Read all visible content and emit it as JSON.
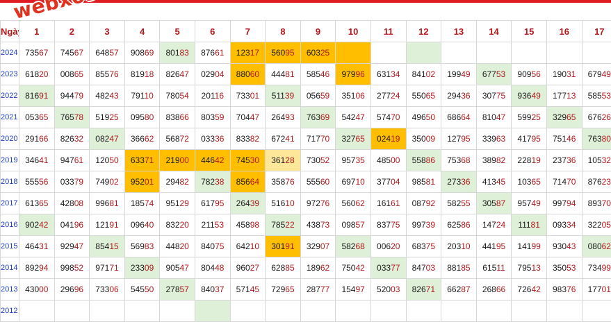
{
  "watermark": "webxoso.net",
  "header": {
    "first_col": "Ngày",
    "days": [
      "1",
      "2",
      "3",
      "4",
      "5",
      "6",
      "7",
      "8",
      "9",
      "10",
      "11",
      "12",
      "13",
      "14",
      "15",
      "16",
      "17"
    ]
  },
  "rows": [
    {
      "year": "2024",
      "cells": [
        {
          "v": "73567",
          "s": "e"
        },
        {
          "v": "74567",
          "s": "e"
        },
        {
          "v": "64857",
          "s": "e"
        },
        {
          "v": "90869",
          "s": "e"
        },
        {
          "v": "80183",
          "s": "g"
        },
        {
          "v": "87661",
          "s": "e"
        },
        {
          "v": "12317",
          "s": "o"
        },
        {
          "v": "56095",
          "s": "o"
        },
        {
          "v": "60325",
          "s": "o"
        },
        {
          "v": "",
          "s": "o"
        },
        {
          "v": "",
          "s": "e"
        },
        {
          "v": "",
          "s": "g"
        },
        {
          "v": "",
          "s": "e"
        },
        {
          "v": "",
          "s": "e"
        },
        {
          "v": "",
          "s": "e"
        },
        {
          "v": "",
          "s": "e"
        },
        {
          "v": "",
          "s": "e"
        }
      ]
    },
    {
      "year": "2023",
      "cells": [
        {
          "v": "61820",
          "s": "e"
        },
        {
          "v": "00865",
          "s": "e"
        },
        {
          "v": "85576",
          "s": "e"
        },
        {
          "v": "81918",
          "s": "e"
        },
        {
          "v": "82647",
          "s": "e"
        },
        {
          "v": "02904",
          "s": "e"
        },
        {
          "v": "88060",
          "s": "o"
        },
        {
          "v": "44481",
          "s": "e"
        },
        {
          "v": "58546",
          "s": "e"
        },
        {
          "v": "97996",
          "s": "o"
        },
        {
          "v": "63134",
          "s": "e"
        },
        {
          "v": "84102",
          "s": "e"
        },
        {
          "v": "19949",
          "s": "e"
        },
        {
          "v": "67753",
          "s": "g"
        },
        {
          "v": "90956",
          "s": "e"
        },
        {
          "v": "19031",
          "s": "e"
        },
        {
          "v": "67949",
          "s": "e"
        }
      ]
    },
    {
      "year": "2022",
      "cells": [
        {
          "v": "81691",
          "s": "g"
        },
        {
          "v": "94479",
          "s": "e"
        },
        {
          "v": "48243",
          "s": "e"
        },
        {
          "v": "79110",
          "s": "e"
        },
        {
          "v": "78054",
          "s": "e"
        },
        {
          "v": "20116",
          "s": "e"
        },
        {
          "v": "73301",
          "s": "e"
        },
        {
          "v": "51139",
          "s": "g"
        },
        {
          "v": "05659",
          "s": "e"
        },
        {
          "v": "35106",
          "s": "e"
        },
        {
          "v": "27724",
          "s": "e"
        },
        {
          "v": "55065",
          "s": "e"
        },
        {
          "v": "29436",
          "s": "e"
        },
        {
          "v": "30775",
          "s": "e"
        },
        {
          "v": "93649",
          "s": "g"
        },
        {
          "v": "17713",
          "s": "e"
        },
        {
          "v": "58553",
          "s": "e"
        }
      ]
    },
    {
      "year": "2021",
      "cells": [
        {
          "v": "05365",
          "s": "e"
        },
        {
          "v": "76578",
          "s": "g"
        },
        {
          "v": "51925",
          "s": "e"
        },
        {
          "v": "09580",
          "s": "e"
        },
        {
          "v": "83866",
          "s": "e"
        },
        {
          "v": "80359",
          "s": "e"
        },
        {
          "v": "70447",
          "s": "e"
        },
        {
          "v": "26493",
          "s": "e"
        },
        {
          "v": "76369",
          "s": "g"
        },
        {
          "v": "54247",
          "s": "e"
        },
        {
          "v": "57470",
          "s": "e"
        },
        {
          "v": "49650",
          "s": "e"
        },
        {
          "v": "68664",
          "s": "e"
        },
        {
          "v": "81047",
          "s": "e"
        },
        {
          "v": "59925",
          "s": "e"
        },
        {
          "v": "32965",
          "s": "g"
        },
        {
          "v": "67626",
          "s": "e"
        }
      ]
    },
    {
      "year": "2020",
      "cells": [
        {
          "v": "29166",
          "s": "e"
        },
        {
          "v": "82632",
          "s": "e"
        },
        {
          "v": "08247",
          "s": "g"
        },
        {
          "v": "36662",
          "s": "e"
        },
        {
          "v": "56872",
          "s": "e"
        },
        {
          "v": "03336",
          "s": "e"
        },
        {
          "v": "83382",
          "s": "e"
        },
        {
          "v": "67241",
          "s": "e"
        },
        {
          "v": "71770",
          "s": "e"
        },
        {
          "v": "32765",
          "s": "g"
        },
        {
          "v": "02419",
          "s": "o"
        },
        {
          "v": "35009",
          "s": "e"
        },
        {
          "v": "12795",
          "s": "e"
        },
        {
          "v": "33963",
          "s": "e"
        },
        {
          "v": "41795",
          "s": "e"
        },
        {
          "v": "75146",
          "s": "e"
        },
        {
          "v": "76380",
          "s": "g"
        }
      ]
    },
    {
      "year": "2019",
      "cells": [
        {
          "v": "34641",
          "s": "e"
        },
        {
          "v": "94761",
          "s": "e"
        },
        {
          "v": "12050",
          "s": "e"
        },
        {
          "v": "63371",
          "s": "o"
        },
        {
          "v": "21900",
          "s": "o"
        },
        {
          "v": "44642",
          "s": "o"
        },
        {
          "v": "74530",
          "s": "o"
        },
        {
          "v": "36128",
          "s": "y"
        },
        {
          "v": "73052",
          "s": "e"
        },
        {
          "v": "95735",
          "s": "e"
        },
        {
          "v": "48500",
          "s": "e"
        },
        {
          "v": "55886",
          "s": "g"
        },
        {
          "v": "75368",
          "s": "e"
        },
        {
          "v": "38982",
          "s": "e"
        },
        {
          "v": "22819",
          "s": "e"
        },
        {
          "v": "23736",
          "s": "e"
        },
        {
          "v": "10532",
          "s": "e"
        }
      ]
    },
    {
      "year": "2018",
      "cells": [
        {
          "v": "55556",
          "s": "e"
        },
        {
          "v": "03379",
          "s": "e"
        },
        {
          "v": "74902",
          "s": "e"
        },
        {
          "v": "95201",
          "s": "o"
        },
        {
          "v": "29482",
          "s": "e"
        },
        {
          "v": "78238",
          "s": "g"
        },
        {
          "v": "85664",
          "s": "o"
        },
        {
          "v": "35876",
          "s": "e"
        },
        {
          "v": "55560",
          "s": "e"
        },
        {
          "v": "69710",
          "s": "e"
        },
        {
          "v": "37704",
          "s": "e"
        },
        {
          "v": "98581",
          "s": "e"
        },
        {
          "v": "27336",
          "s": "g"
        },
        {
          "v": "41345",
          "s": "e"
        },
        {
          "v": "10365",
          "s": "e"
        },
        {
          "v": "71470",
          "s": "e"
        },
        {
          "v": "87623",
          "s": "e"
        }
      ]
    },
    {
      "year": "2017",
      "cells": [
        {
          "v": "61365",
          "s": "e"
        },
        {
          "v": "42808",
          "s": "e"
        },
        {
          "v": "99681",
          "s": "e"
        },
        {
          "v": "18574",
          "s": "e"
        },
        {
          "v": "95129",
          "s": "e"
        },
        {
          "v": "61795",
          "s": "e"
        },
        {
          "v": "26439",
          "s": "g"
        },
        {
          "v": "51610",
          "s": "e"
        },
        {
          "v": "97276",
          "s": "e"
        },
        {
          "v": "56062",
          "s": "e"
        },
        {
          "v": "16161",
          "s": "e"
        },
        {
          "v": "08792",
          "s": "e"
        },
        {
          "v": "58255",
          "s": "e"
        },
        {
          "v": "30587",
          "s": "g"
        },
        {
          "v": "95749",
          "s": "e"
        },
        {
          "v": "99794",
          "s": "e"
        },
        {
          "v": "89370",
          "s": "e"
        }
      ]
    },
    {
      "year": "2016",
      "cells": [
        {
          "v": "90242",
          "s": "g"
        },
        {
          "v": "04196",
          "s": "e"
        },
        {
          "v": "12191",
          "s": "e"
        },
        {
          "v": "09640",
          "s": "e"
        },
        {
          "v": "83220",
          "s": "e"
        },
        {
          "v": "21153",
          "s": "e"
        },
        {
          "v": "45898",
          "s": "e"
        },
        {
          "v": "78522",
          "s": "g"
        },
        {
          "v": "43873",
          "s": "e"
        },
        {
          "v": "09857",
          "s": "e"
        },
        {
          "v": "83775",
          "s": "e"
        },
        {
          "v": "99739",
          "s": "e"
        },
        {
          "v": "62586",
          "s": "e"
        },
        {
          "v": "14724",
          "s": "e"
        },
        {
          "v": "11181",
          "s": "g"
        },
        {
          "v": "09334",
          "s": "e"
        },
        {
          "v": "32205",
          "s": "e"
        }
      ]
    },
    {
      "year": "2015",
      "cells": [
        {
          "v": "46431",
          "s": "e"
        },
        {
          "v": "92947",
          "s": "e"
        },
        {
          "v": "85415",
          "s": "g"
        },
        {
          "v": "56983",
          "s": "e"
        },
        {
          "v": "44820",
          "s": "e"
        },
        {
          "v": "84075",
          "s": "e"
        },
        {
          "v": "64210",
          "s": "e"
        },
        {
          "v": "30191",
          "s": "o"
        },
        {
          "v": "32907",
          "s": "e"
        },
        {
          "v": "58268",
          "s": "g"
        },
        {
          "v": "00620",
          "s": "e"
        },
        {
          "v": "68375",
          "s": "e"
        },
        {
          "v": "20310",
          "s": "e"
        },
        {
          "v": "44195",
          "s": "e"
        },
        {
          "v": "14199",
          "s": "e"
        },
        {
          "v": "93043",
          "s": "e"
        },
        {
          "v": "08062",
          "s": "g"
        }
      ]
    },
    {
      "year": "2014",
      "cells": [
        {
          "v": "89294",
          "s": "e"
        },
        {
          "v": "99852",
          "s": "e"
        },
        {
          "v": "97171",
          "s": "e"
        },
        {
          "v": "23309",
          "s": "g"
        },
        {
          "v": "90547",
          "s": "e"
        },
        {
          "v": "80448",
          "s": "e"
        },
        {
          "v": "96027",
          "s": "e"
        },
        {
          "v": "62885",
          "s": "e"
        },
        {
          "v": "18962",
          "s": "e"
        },
        {
          "v": "75042",
          "s": "e"
        },
        {
          "v": "03377",
          "s": "g"
        },
        {
          "v": "84703",
          "s": "e"
        },
        {
          "v": "88185",
          "s": "e"
        },
        {
          "v": "61511",
          "s": "e"
        },
        {
          "v": "79513",
          "s": "e"
        },
        {
          "v": "35053",
          "s": "e"
        },
        {
          "v": "73499",
          "s": "e"
        }
      ]
    },
    {
      "year": "2013",
      "cells": [
        {
          "v": "43000",
          "s": "e"
        },
        {
          "v": "29696",
          "s": "e"
        },
        {
          "v": "73306",
          "s": "e"
        },
        {
          "v": "54550",
          "s": "e"
        },
        {
          "v": "27857",
          "s": "g"
        },
        {
          "v": "84037",
          "s": "e"
        },
        {
          "v": "57145",
          "s": "e"
        },
        {
          "v": "72965",
          "s": "e"
        },
        {
          "v": "28777",
          "s": "e"
        },
        {
          "v": "15497",
          "s": "e"
        },
        {
          "v": "52003",
          "s": "e"
        },
        {
          "v": "82671",
          "s": "g"
        },
        {
          "v": "66287",
          "s": "e"
        },
        {
          "v": "26866",
          "s": "e"
        },
        {
          "v": "72642",
          "s": "e"
        },
        {
          "v": "98376",
          "s": "e"
        },
        {
          "v": "17701",
          "s": "e"
        }
      ]
    },
    {
      "year": "2012",
      "cells": [
        {
          "v": "",
          "s": "e"
        },
        {
          "v": "",
          "s": "e"
        },
        {
          "v": "",
          "s": "e"
        },
        {
          "v": "",
          "s": "e"
        },
        {
          "v": "",
          "s": "e"
        },
        {
          "v": "",
          "s": "g"
        },
        {
          "v": "",
          "s": "e"
        },
        {
          "v": "",
          "s": "e"
        },
        {
          "v": "",
          "s": "e"
        },
        {
          "v": "",
          "s": "e"
        },
        {
          "v": "",
          "s": "e"
        },
        {
          "v": "",
          "s": "e"
        },
        {
          "v": "",
          "s": "e"
        },
        {
          "v": "",
          "s": "e"
        },
        {
          "v": "",
          "s": "e"
        },
        {
          "v": "",
          "s": "e"
        },
        {
          "v": "",
          "s": "e"
        }
      ]
    }
  ]
}
